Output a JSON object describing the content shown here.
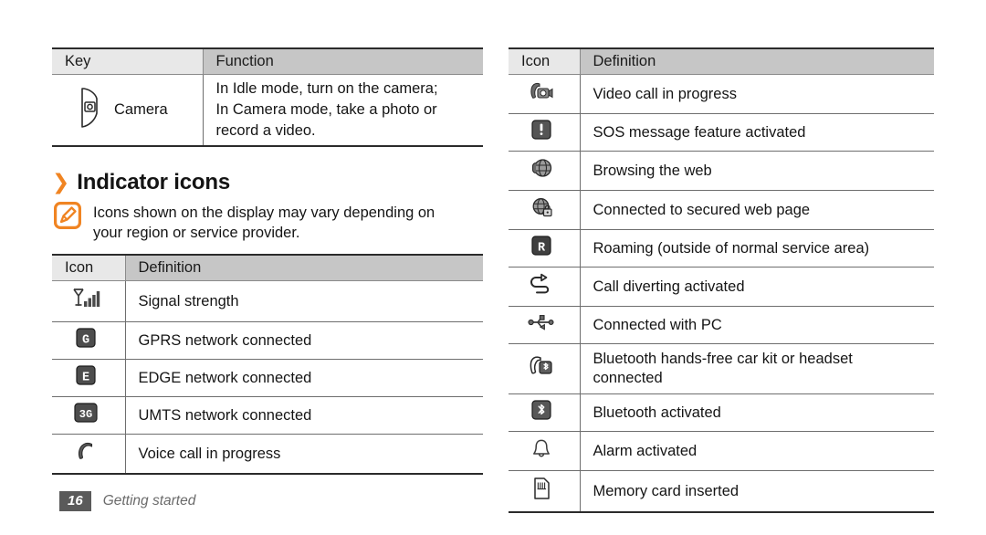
{
  "key_table": {
    "headers": {
      "key": "Key",
      "function": "Function"
    },
    "rows": [
      {
        "icon": "camera-key-icon",
        "key_label": "Camera",
        "function_lines": [
          "In Idle mode, turn on the camera;",
          "In Camera mode, take a photo or",
          "record a video."
        ]
      }
    ]
  },
  "section": {
    "chevron": "❯",
    "title": "Indicator icons",
    "note": {
      "icon": "note-pencil-icon",
      "lines": [
        "Icons shown on the display may vary depending on",
        "your region or service provider."
      ]
    }
  },
  "indicator_table_left": {
    "headers": {
      "icon": "Icon",
      "definition": "Definition"
    },
    "rows": [
      {
        "icon": "signal-strength-icon",
        "definition": "Signal strength"
      },
      {
        "icon": "gprs-icon",
        "definition": "GPRS network connected"
      },
      {
        "icon": "edge-icon",
        "definition": "EDGE network connected"
      },
      {
        "icon": "umts-3g-icon",
        "definition": "UMTS network connected"
      },
      {
        "icon": "voice-call-icon",
        "definition": "Voice call in progress"
      }
    ]
  },
  "indicator_table_right": {
    "headers": {
      "icon": "Icon",
      "definition": "Definition"
    },
    "rows": [
      {
        "icon": "video-call-icon",
        "definition": "Video call in progress"
      },
      {
        "icon": "sos-message-icon",
        "definition": "SOS message feature activated"
      },
      {
        "icon": "web-browsing-icon",
        "definition": "Browsing the web"
      },
      {
        "icon": "secure-web-icon",
        "definition": "Connected to secured web page"
      },
      {
        "icon": "roaming-icon",
        "definition": "Roaming (outside of normal service area)"
      },
      {
        "icon": "call-diverting-icon",
        "definition": "Call diverting activated"
      },
      {
        "icon": "usb-pc-icon",
        "definition": "Connected with PC"
      },
      {
        "icon": "bluetooth-headset-icon",
        "definition_lines": [
          "Bluetooth hands-free car kit or headset",
          "connected"
        ]
      },
      {
        "icon": "bluetooth-icon",
        "definition": "Bluetooth activated"
      },
      {
        "icon": "alarm-icon",
        "definition": "Alarm activated"
      },
      {
        "icon": "memory-card-icon",
        "definition": "Memory card inserted"
      }
    ]
  },
  "footer": {
    "page_number": "16",
    "label": "Getting started"
  },
  "colors": {
    "accent_orange": "#f08422",
    "header_light": "#e8e8e8",
    "header_dark": "#c6c6c6",
    "rule_dark": "#2b2b2b",
    "rule_light": "#6e6e6e",
    "page_badge": "#5a5a5a",
    "footer_text": "#6b6b6b"
  }
}
